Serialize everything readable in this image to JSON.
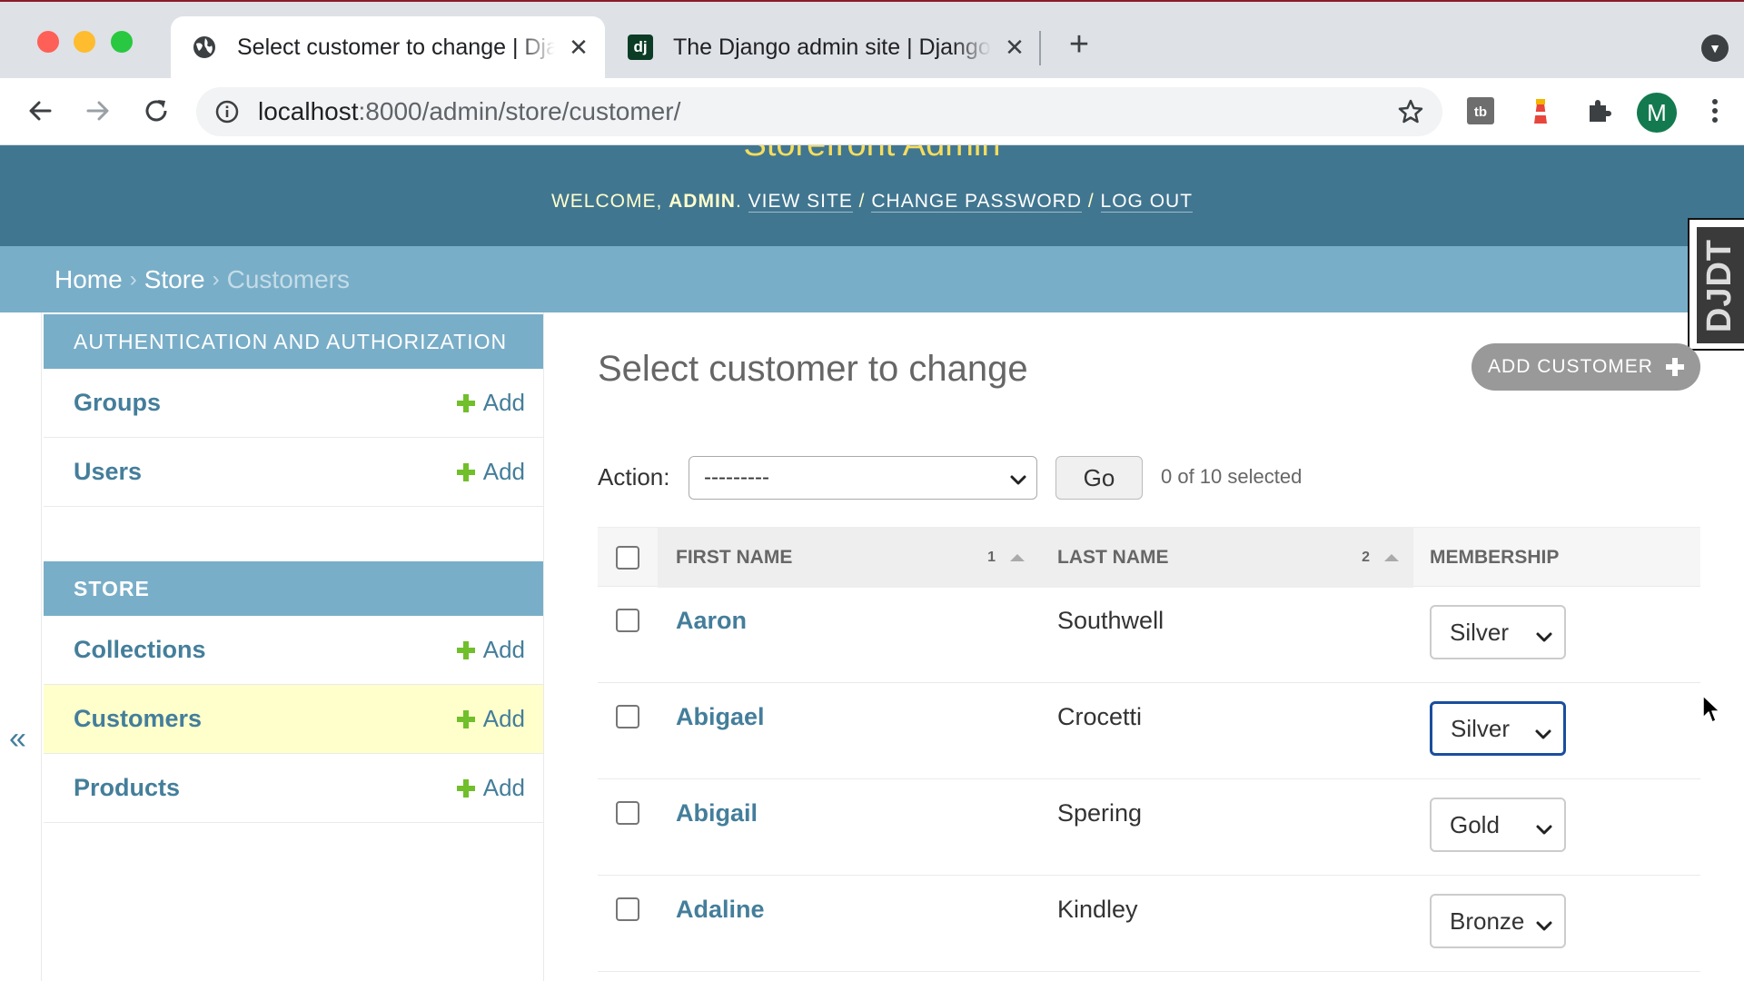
{
  "browser": {
    "tabs": [
      {
        "title": "Select customer to change | Django site admin",
        "active": true,
        "favicon": "globe-icon"
      },
      {
        "title": "The Django admin site | Django documentation",
        "active": false,
        "favicon": "dj",
        "favicon_label": "dj"
      }
    ],
    "url_host": "localhost",
    "url_path": ":8000/admin/store/customer/",
    "profile_initial": "M"
  },
  "header": {
    "site_name": "Storefront Admin",
    "welcome": "Welcome,",
    "username": "admin",
    "view_site": "View site",
    "change_password": "Change password",
    "log_out": "Log out",
    "sep": "/"
  },
  "breadcrumbs": {
    "home": "Home",
    "app": "Store",
    "current": "Customers",
    "separator": "›"
  },
  "djdt": {
    "label": "DJDT"
  },
  "sidebar": {
    "modules": [
      {
        "caption": "Authentication and Authorization",
        "models": [
          {
            "name": "Groups",
            "add": "Add"
          },
          {
            "name": "Users",
            "add": "Add"
          }
        ]
      },
      {
        "caption": "Store",
        "models": [
          {
            "name": "Collections",
            "add": "Add"
          },
          {
            "name": "Customers",
            "add": "Add",
            "current": true
          },
          {
            "name": "Products",
            "add": "Add"
          }
        ]
      }
    ],
    "collapse_label": "«"
  },
  "content": {
    "title": "Select customer to change",
    "add_button": "Add customer",
    "action_label": "Action:",
    "action_value": "---------",
    "go_label": "Go",
    "selected_counter": "0 of 10 selected",
    "columns": {
      "first_name": "First name",
      "first_name_sort": "1",
      "last_name": "Last name",
      "last_name_sort": "2",
      "membership": "Membership"
    },
    "rows": [
      {
        "first_name": "Aaron",
        "last_name": "Southwell",
        "membership": "Silver"
      },
      {
        "first_name": "Abigael",
        "last_name": "Crocetti",
        "membership": "Silver"
      },
      {
        "first_name": "Abigail",
        "last_name": "Spering",
        "membership": "Gold"
      },
      {
        "first_name": "Adaline",
        "last_name": "Kindley",
        "membership": "Bronze"
      }
    ]
  },
  "colors": {
    "header_bg": "#417690",
    "breadcrumb_bg": "#79aec8",
    "site_name": "#f5dd5d",
    "link": "#447e9b",
    "add_green": "#70bf2b",
    "current_row": "#ffffcc"
  }
}
